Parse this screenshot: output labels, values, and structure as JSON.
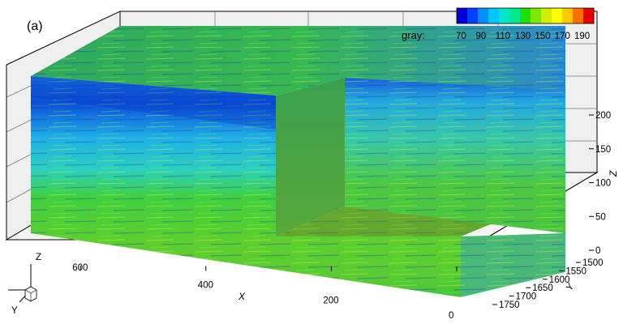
{
  "panel_label": "(a)",
  "colorbar": {
    "title": "gray:",
    "tick_labels": [
      "70",
      "90",
      "110",
      "130",
      "150",
      "170",
      "190"
    ],
    "colors": [
      "#0000d8",
      "#0040ff",
      "#0090ff",
      "#00c8ff",
      "#00e8c8",
      "#00e890",
      "#20e000",
      "#80e800",
      "#d0f000",
      "#ffff00",
      "#ffc800",
      "#ff7000",
      "#e80000"
    ]
  },
  "chart_data": {
    "type": "volume-slice",
    "title": "",
    "axes": {
      "x": {
        "label": "X",
        "ticks": [
          600,
          400,
          200,
          0
        ],
        "range": [
          0,
          700
        ]
      },
      "y": {
        "label": "Y",
        "ticks": [
          1500,
          1550,
          1600,
          1650,
          1700,
          1750
        ],
        "range": [
          1500,
          1780
        ]
      },
      "z": {
        "label": "Z",
        "ticks": [
          0,
          50,
          100,
          150,
          200
        ],
        "range": [
          0,
          250
        ]
      }
    },
    "variable": "gray",
    "value_range": [
      70,
      190
    ],
    "grid": true,
    "legend_position": "top-right"
  },
  "orientation_triad": {
    "z_label": "Z",
    "y_label": "Y"
  }
}
